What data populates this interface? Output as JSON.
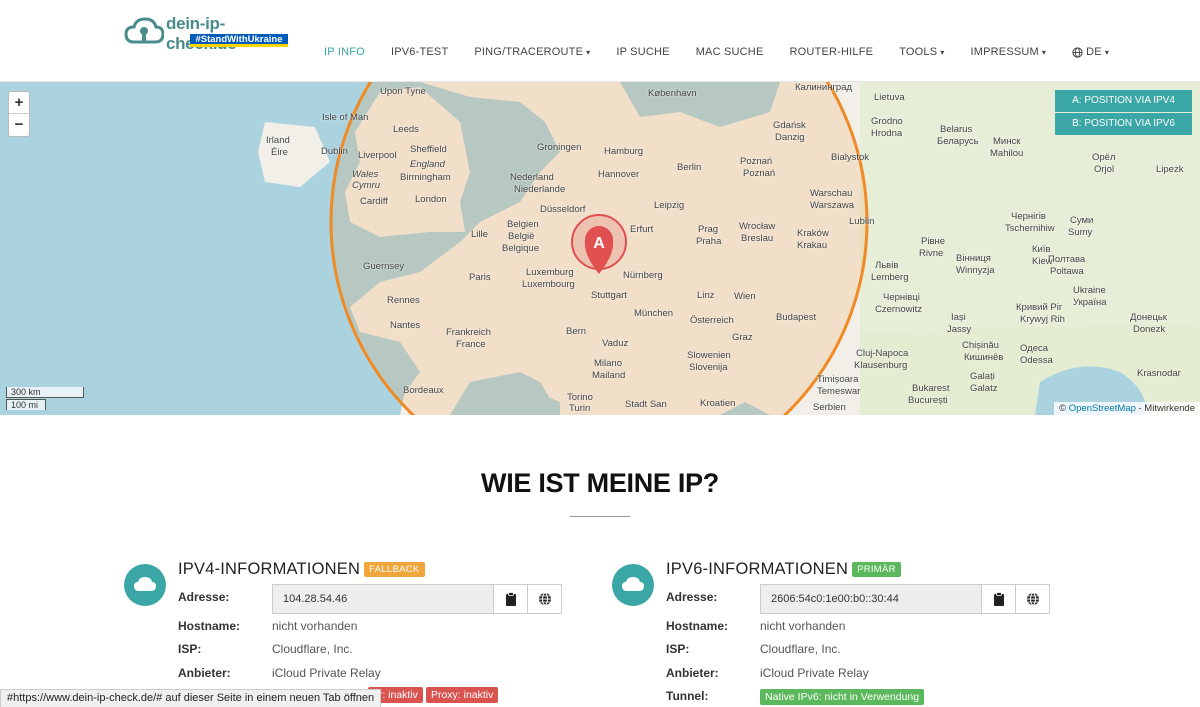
{
  "brand": {
    "name": "dein-ip-check.de",
    "tagline": "#StandWithUkraine"
  },
  "nav": {
    "items": [
      {
        "label": "IP INFO",
        "active": true,
        "dropdown": false
      },
      {
        "label": "IPV6-TEST",
        "active": false,
        "dropdown": false
      },
      {
        "label": "PING/TRACEROUTE",
        "active": false,
        "dropdown": true
      },
      {
        "label": "IP SUCHE",
        "active": false,
        "dropdown": false
      },
      {
        "label": "MAC SUCHE",
        "active": false,
        "dropdown": false
      },
      {
        "label": "ROUTER-HILFE",
        "active": false,
        "dropdown": false
      },
      {
        "label": "TOOLS",
        "active": false,
        "dropdown": true
      },
      {
        "label": "IMPRESSUM",
        "active": false,
        "dropdown": true
      }
    ],
    "lang": "DE"
  },
  "map": {
    "zoom_in": "+",
    "zoom_out": "−",
    "scale_km": "300 km",
    "scale_mi": "100 mi",
    "btn_ipv4": "A: POSITION VIA IPV4",
    "btn_ipv6": "B: POSITION VIA IPV6",
    "marker": "A",
    "attrib_prefix": "©",
    "attrib_osm": "OpenStreetMap",
    "attrib_suffix": "- Mitwirkende",
    "cities": [
      "Upon Tyne",
      "København",
      "Калининград",
      "Lietuva",
      "Isle of Man",
      "Leeds",
      "Irland",
      "Éire",
      "Dublin",
      "Liverpool",
      "Sheffield",
      "England",
      "Birmingham",
      "Wales",
      "Cymru",
      "Cardiff",
      "London",
      "Groningen",
      "Hamburg",
      "Nederland",
      "Niederlande",
      "Hannover",
      "Berlin",
      "Poznań",
      "Poznań",
      "Gdańsk",
      "Danzig",
      "Belgien",
      "België",
      "Belgique",
      "Lille",
      "Düsseldorf",
      "Leipzig",
      "Warschau",
      "Warszawa",
      "Erfurt",
      "Prag",
      "Praha",
      "Wrocław",
      "Breslau",
      "Kraków",
      "Krakau",
      "Paris",
      "Luxemburg",
      "Luxembourg",
      "Nürnberg",
      "Stuttgart",
      "Guernsey",
      "Rennes",
      "Nantes",
      "Frankreich",
      "France",
      "München",
      "Linz",
      "Wien",
      "Österreich",
      "Budapest",
      "Bern",
      "Vaduz",
      "Graz",
      "Milano",
      "Mailand",
      "Slowenien",
      "Slovenija",
      "Bordeaux",
      "Torino",
      "Turin",
      "Stadt San",
      "Kroatien",
      "Belarus",
      "Беларусь",
      "Минск",
      "Mahilou",
      "Орёл",
      "Orjol",
      "Lipezk",
      "Grodno",
      "Hrodna",
      "Рівне",
      "Rivne",
      "Київ",
      "Kiew",
      "Львів",
      "Lemberg",
      "Вінниця",
      "Winnyzja",
      "Полтава",
      "Poltawa",
      "Чернігів",
      "Tschernihiw",
      "Суми",
      "Sumy",
      "Чернівці",
      "Czernowitz",
      "Iași",
      "Jassy",
      "Кривий Ріг",
      "Krywyj Rih",
      "Chișinău",
      "Кишинёв",
      "Одеса",
      "Odessa",
      "Cluj-Napoca",
      "Klausenburg",
      "Timișoara",
      "Temeswar",
      "Bukarest",
      "București",
      "Serbien",
      "Galați",
      "Galatz",
      "Донецьк",
      "Donezk",
      "Krasnodar",
      "Ukraine",
      "Україна",
      "Bialystok",
      "Lublin"
    ]
  },
  "page_title": "WIE IST MEINE IP?",
  "ipv4": {
    "title": "IPV4-INFORMATIONEN",
    "badge": "FALLBACK",
    "address_label": "Adresse:",
    "address": "104.28.54.46",
    "hostname_label": "Hostname:",
    "hostname": "nicht vorhanden",
    "isp_label": "ISP:",
    "isp": "Cloudflare, Inc.",
    "provider_label": "Anbieter:",
    "provider": "iCloud Private Relay",
    "tag_tor": "or: inaktiv",
    "tag_proxy": "Proxy: inaktiv"
  },
  "ipv6": {
    "title": "IPV6-INFORMATIONEN",
    "badge": "PRIMÄR",
    "address_label": "Adresse:",
    "address": "2606:54c0:1e00:b0::30:44",
    "hostname_label": "Hostname:",
    "hostname": "nicht vorhanden",
    "isp_label": "ISP:",
    "isp": "Cloudflare, Inc.",
    "provider_label": "Anbieter:",
    "provider": "iCloud Private Relay",
    "tunnel_label": "Tunnel:",
    "tunnel": "Native IPv6: nicht in Verwendung"
  },
  "status_bar": "#https://www.dein-ip-check.de/# auf dieser Seite in einem neuen Tab öffnen",
  "colors": {
    "accent": "#3aa6a6",
    "orange": "#f0a63a",
    "green": "#5cb85c",
    "red": "#d9534f",
    "circle": "#f08a24"
  }
}
